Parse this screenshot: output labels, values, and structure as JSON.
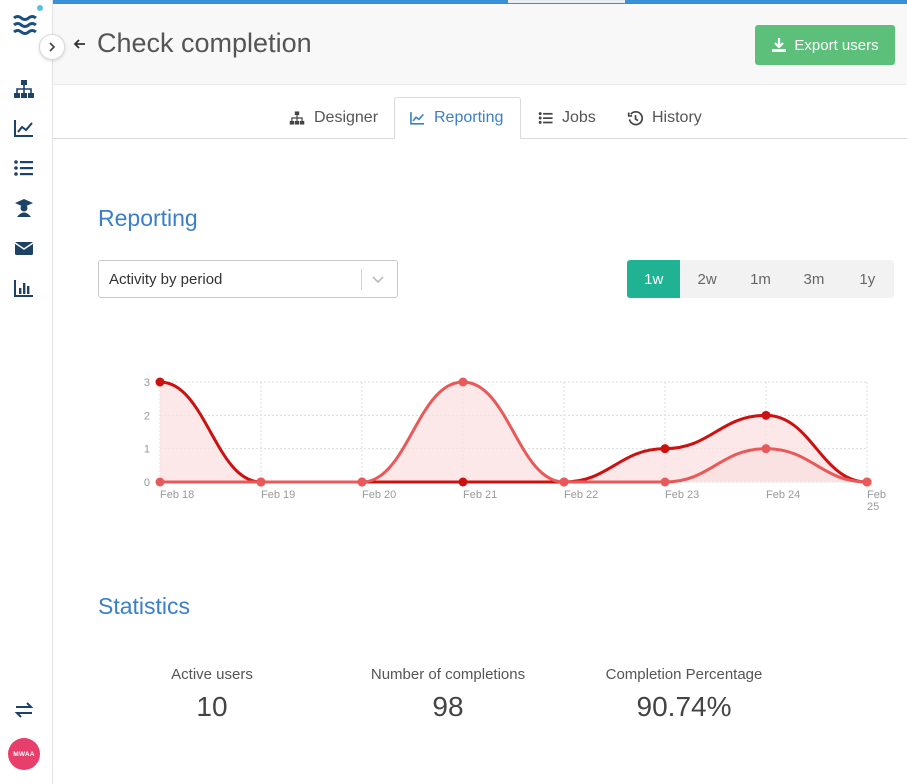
{
  "app": {
    "title": "Check completion",
    "export_label": "Export users",
    "avatar_initials": "MWAA",
    "accent": "#3a7fc8",
    "export_color": "#5cc07a",
    "active_period_color": "#1fb394"
  },
  "sidebar": {
    "items": [
      {
        "icon": "sitemap-icon"
      },
      {
        "icon": "line-chart-icon"
      },
      {
        "icon": "list-icon"
      },
      {
        "icon": "graduate-icon"
      },
      {
        "icon": "envelope-icon"
      },
      {
        "icon": "bar-chart-icon"
      }
    ],
    "bottom_icon": "exchange-icon"
  },
  "tabs": [
    {
      "label": "Designer",
      "icon": "sitemap-icon",
      "active": false
    },
    {
      "label": "Reporting",
      "icon": "line-chart-icon",
      "active": true
    },
    {
      "label": "Jobs",
      "icon": "list-icon",
      "active": false
    },
    {
      "label": "History",
      "icon": "history-icon",
      "active": false
    }
  ],
  "reporting": {
    "title": "Reporting",
    "select_value": "Activity by period",
    "periods": [
      "1w",
      "2w",
      "1m",
      "3m",
      "1y"
    ],
    "active_period": "1w"
  },
  "chart_data": {
    "type": "area",
    "x": [
      "Feb 18",
      "Feb 19",
      "Feb 20",
      "Feb 21",
      "Feb 22",
      "Feb 23",
      "Feb 24",
      "Feb 25"
    ],
    "series": [
      {
        "values": [
          3,
          0,
          0,
          0,
          0,
          1,
          2,
          0
        ],
        "color": "#cc1111"
      },
      {
        "values": [
          0,
          0,
          0,
          3,
          0,
          0,
          1,
          0
        ],
        "color": "#e85a5a"
      }
    ],
    "ylim": [
      0,
      3
    ],
    "yticks": [
      0,
      1,
      2,
      3
    ],
    "grid": true,
    "fill_color": "#fbe0e0"
  },
  "statistics": {
    "title": "Statistics",
    "items": [
      {
        "label": "Active users",
        "value": "10"
      },
      {
        "label": "Number of completions",
        "value": "98"
      },
      {
        "label": "Completion Percentage",
        "value": "90.74%"
      }
    ]
  }
}
